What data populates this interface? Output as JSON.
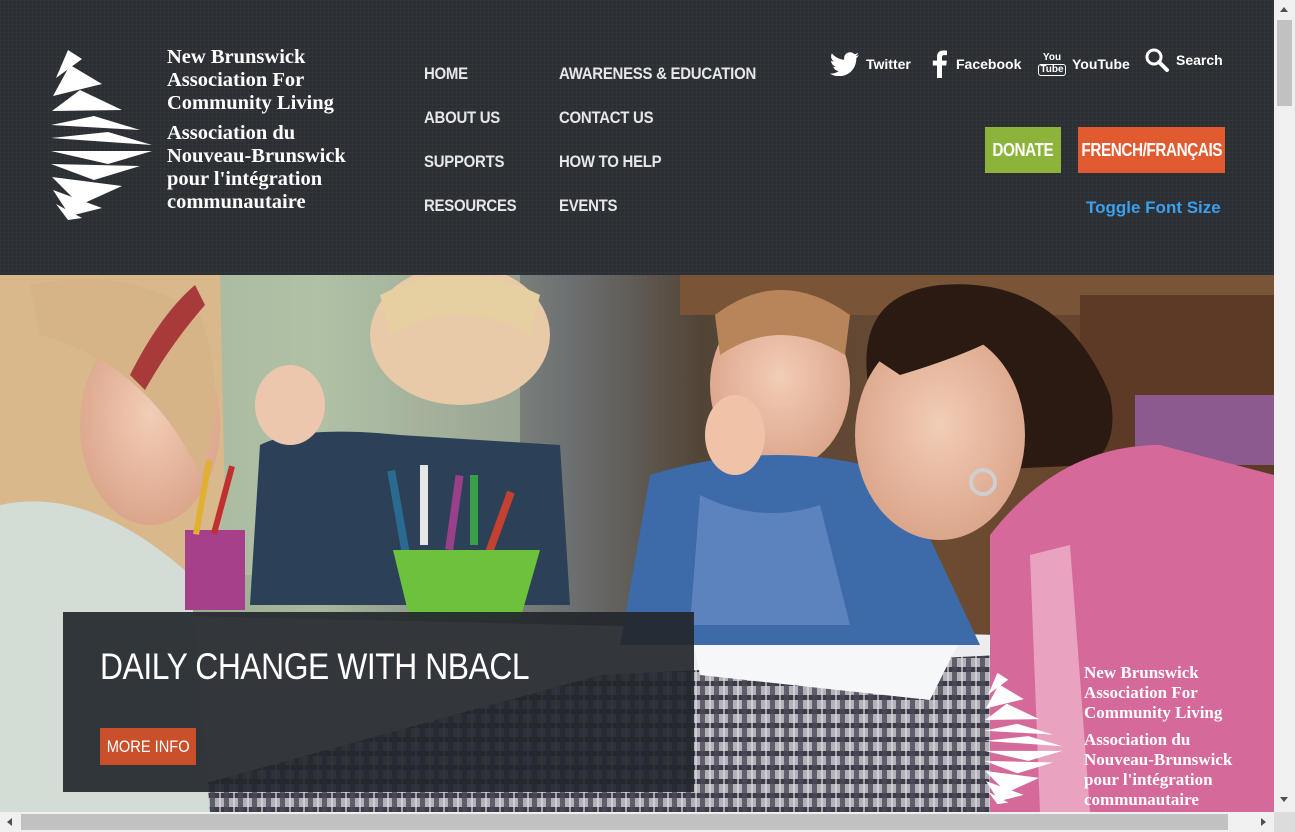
{
  "logo": {
    "en": [
      "New Brunswick",
      "Association For",
      "Community Living"
    ],
    "fr": [
      "Association du",
      "Nouveau-Brunswick",
      "pour l'intégration",
      "communautaire"
    ]
  },
  "nav": {
    "col1": [
      "HOME",
      "ABOUT US",
      "SUPPORTS",
      "RESOURCES"
    ],
    "col2": [
      "AWARENESS & EDUCATION",
      "CONTACT US",
      "HOW TO HELP",
      "EVENTS"
    ]
  },
  "social": {
    "twitter": "Twitter",
    "facebook": "Facebook",
    "youtube": "YouTube",
    "youtube_icon_text": [
      "You",
      "Tube"
    ],
    "search": "Search"
  },
  "buttons": {
    "donate": "DONATE",
    "french": "FRENCH/FRANÇAIS",
    "toggle_font": "Toggle Font Size"
  },
  "hero": {
    "title": "DAILY CHANGE WITH NBACL",
    "button": "MORE INFO"
  },
  "colors": {
    "header_bg": "#2b2e33",
    "donate": "#8cb33a",
    "french": "#e15a30",
    "more_info": "#c9502a",
    "toggle_link": "#3aa0f0"
  },
  "icons": [
    "twitter-icon",
    "facebook-icon",
    "youtube-icon",
    "search-icon",
    "logo-mark"
  ]
}
